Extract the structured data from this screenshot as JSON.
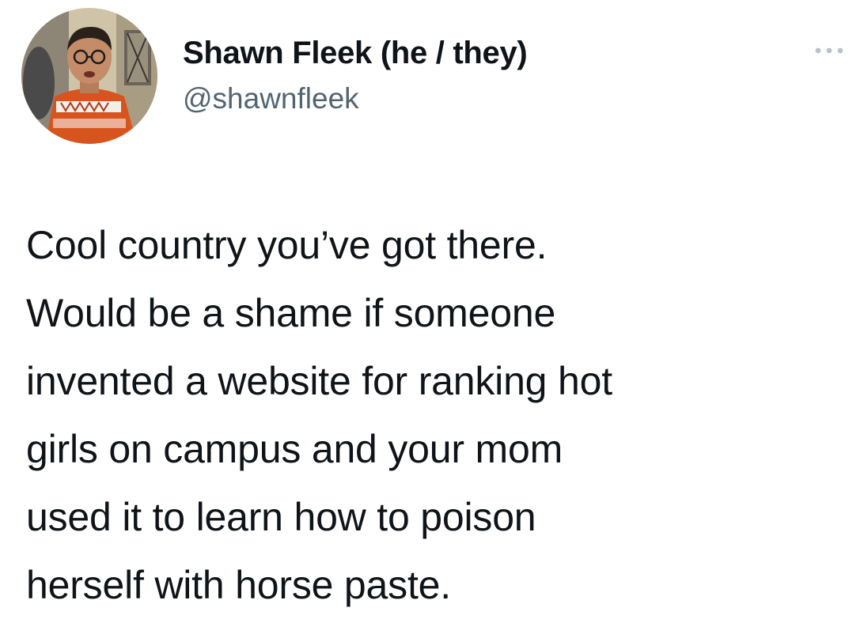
{
  "author": {
    "display_name": "Shawn Fleek (he / they)",
    "handle": "@shawnfleek"
  },
  "tweet": {
    "text": "Cool country you’ve got there.\nWould be a shame if someone\ninvented a website for ranking hot\ngirls on campus and your mom\nused it to learn how to poison\nherself with horse paste."
  },
  "icons": {
    "more": "more-options-icon",
    "avatar": "profile-photo"
  },
  "colors": {
    "text_primary": "#0f1419",
    "text_secondary": "#536471",
    "background": "#ffffff"
  }
}
